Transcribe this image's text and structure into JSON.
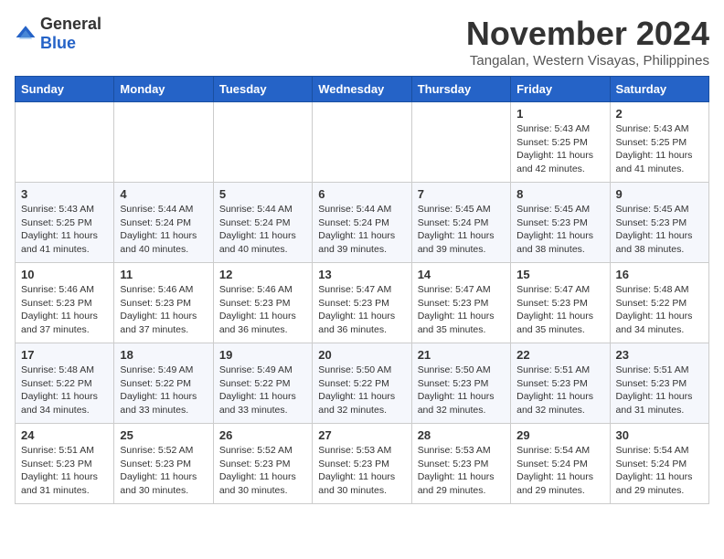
{
  "logo": {
    "general": "General",
    "blue": "Blue"
  },
  "title": "November 2024",
  "location": "Tangalan, Western Visayas, Philippines",
  "weekdays": [
    "Sunday",
    "Monday",
    "Tuesday",
    "Wednesday",
    "Thursday",
    "Friday",
    "Saturday"
  ],
  "weeks": [
    [
      {
        "day": "",
        "info": ""
      },
      {
        "day": "",
        "info": ""
      },
      {
        "day": "",
        "info": ""
      },
      {
        "day": "",
        "info": ""
      },
      {
        "day": "",
        "info": ""
      },
      {
        "day": "1",
        "info": "Sunrise: 5:43 AM\nSunset: 5:25 PM\nDaylight: 11 hours and 42 minutes."
      },
      {
        "day": "2",
        "info": "Sunrise: 5:43 AM\nSunset: 5:25 PM\nDaylight: 11 hours and 41 minutes."
      }
    ],
    [
      {
        "day": "3",
        "info": "Sunrise: 5:43 AM\nSunset: 5:25 PM\nDaylight: 11 hours and 41 minutes."
      },
      {
        "day": "4",
        "info": "Sunrise: 5:44 AM\nSunset: 5:24 PM\nDaylight: 11 hours and 40 minutes."
      },
      {
        "day": "5",
        "info": "Sunrise: 5:44 AM\nSunset: 5:24 PM\nDaylight: 11 hours and 40 minutes."
      },
      {
        "day": "6",
        "info": "Sunrise: 5:44 AM\nSunset: 5:24 PM\nDaylight: 11 hours and 39 minutes."
      },
      {
        "day": "7",
        "info": "Sunrise: 5:45 AM\nSunset: 5:24 PM\nDaylight: 11 hours and 39 minutes."
      },
      {
        "day": "8",
        "info": "Sunrise: 5:45 AM\nSunset: 5:23 PM\nDaylight: 11 hours and 38 minutes."
      },
      {
        "day": "9",
        "info": "Sunrise: 5:45 AM\nSunset: 5:23 PM\nDaylight: 11 hours and 38 minutes."
      }
    ],
    [
      {
        "day": "10",
        "info": "Sunrise: 5:46 AM\nSunset: 5:23 PM\nDaylight: 11 hours and 37 minutes."
      },
      {
        "day": "11",
        "info": "Sunrise: 5:46 AM\nSunset: 5:23 PM\nDaylight: 11 hours and 37 minutes."
      },
      {
        "day": "12",
        "info": "Sunrise: 5:46 AM\nSunset: 5:23 PM\nDaylight: 11 hours and 36 minutes."
      },
      {
        "day": "13",
        "info": "Sunrise: 5:47 AM\nSunset: 5:23 PM\nDaylight: 11 hours and 36 minutes."
      },
      {
        "day": "14",
        "info": "Sunrise: 5:47 AM\nSunset: 5:23 PM\nDaylight: 11 hours and 35 minutes."
      },
      {
        "day": "15",
        "info": "Sunrise: 5:47 AM\nSunset: 5:23 PM\nDaylight: 11 hours and 35 minutes."
      },
      {
        "day": "16",
        "info": "Sunrise: 5:48 AM\nSunset: 5:22 PM\nDaylight: 11 hours and 34 minutes."
      }
    ],
    [
      {
        "day": "17",
        "info": "Sunrise: 5:48 AM\nSunset: 5:22 PM\nDaylight: 11 hours and 34 minutes."
      },
      {
        "day": "18",
        "info": "Sunrise: 5:49 AM\nSunset: 5:22 PM\nDaylight: 11 hours and 33 minutes."
      },
      {
        "day": "19",
        "info": "Sunrise: 5:49 AM\nSunset: 5:22 PM\nDaylight: 11 hours and 33 minutes."
      },
      {
        "day": "20",
        "info": "Sunrise: 5:50 AM\nSunset: 5:22 PM\nDaylight: 11 hours and 32 minutes."
      },
      {
        "day": "21",
        "info": "Sunrise: 5:50 AM\nSunset: 5:23 PM\nDaylight: 11 hours and 32 minutes."
      },
      {
        "day": "22",
        "info": "Sunrise: 5:51 AM\nSunset: 5:23 PM\nDaylight: 11 hours and 32 minutes."
      },
      {
        "day": "23",
        "info": "Sunrise: 5:51 AM\nSunset: 5:23 PM\nDaylight: 11 hours and 31 minutes."
      }
    ],
    [
      {
        "day": "24",
        "info": "Sunrise: 5:51 AM\nSunset: 5:23 PM\nDaylight: 11 hours and 31 minutes."
      },
      {
        "day": "25",
        "info": "Sunrise: 5:52 AM\nSunset: 5:23 PM\nDaylight: 11 hours and 30 minutes."
      },
      {
        "day": "26",
        "info": "Sunrise: 5:52 AM\nSunset: 5:23 PM\nDaylight: 11 hours and 30 minutes."
      },
      {
        "day": "27",
        "info": "Sunrise: 5:53 AM\nSunset: 5:23 PM\nDaylight: 11 hours and 30 minutes."
      },
      {
        "day": "28",
        "info": "Sunrise: 5:53 AM\nSunset: 5:23 PM\nDaylight: 11 hours and 29 minutes."
      },
      {
        "day": "29",
        "info": "Sunrise: 5:54 AM\nSunset: 5:24 PM\nDaylight: 11 hours and 29 minutes."
      },
      {
        "day": "30",
        "info": "Sunrise: 5:54 AM\nSunset: 5:24 PM\nDaylight: 11 hours and 29 minutes."
      }
    ]
  ]
}
